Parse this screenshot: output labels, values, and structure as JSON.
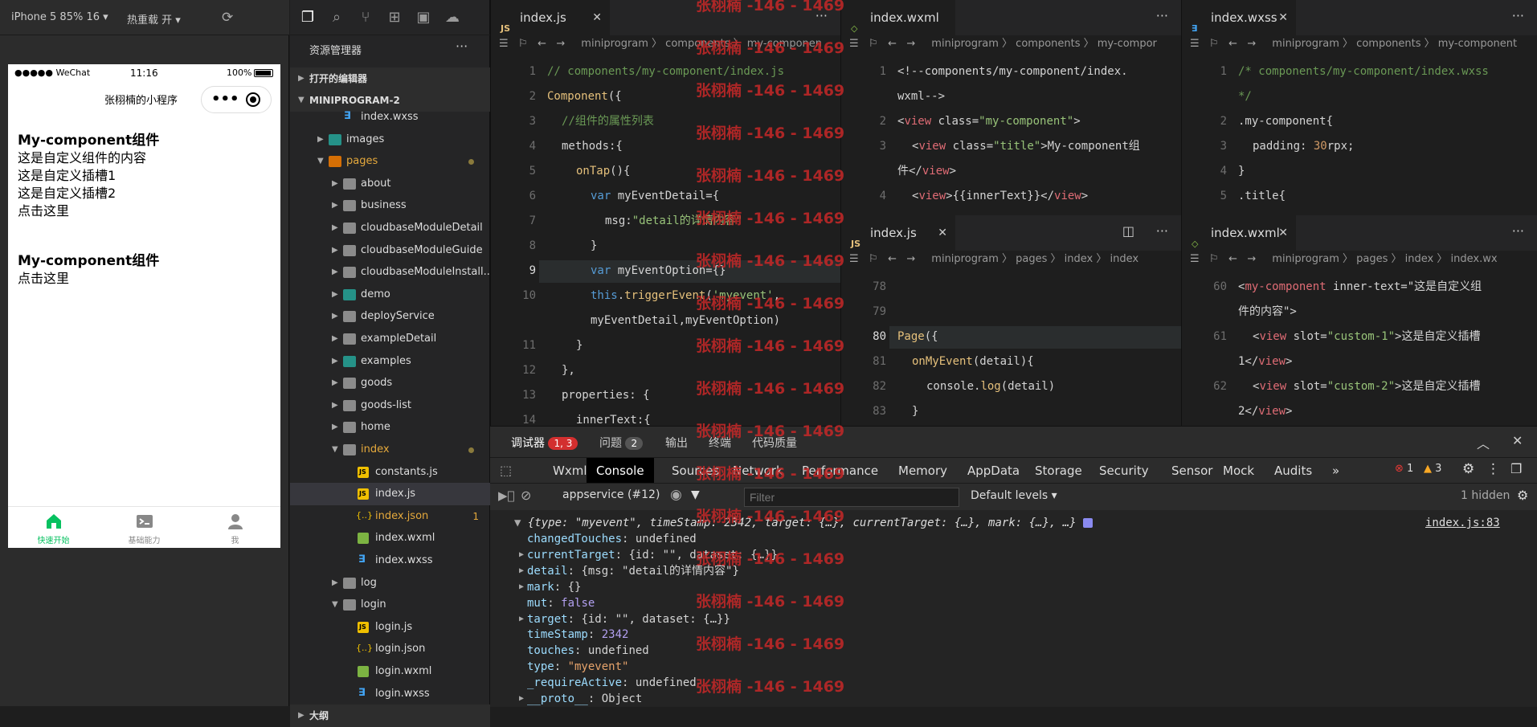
{
  "simulator": {
    "device": "iPhone 5 85% 16 ▾",
    "hot_reload": "热重载 开 ▾",
    "status": {
      "carrier": "●●●●● WeChat",
      "time": "11:16",
      "battery": "100%"
    },
    "nav_title": "张栩楠的小程序",
    "capsule_menu": "•••",
    "content": {
      "c1_title": "My-component组件",
      "c1_text": "这是自定义组件的内容",
      "c1_slot1": "这是自定义插槽1",
      "c1_slot2": "这是自定义插槽2",
      "c1_click": "点击这里",
      "c2_title": "My-component组件",
      "c2_click": "点击这里"
    },
    "tabs": [
      {
        "label": "快速开始",
        "color": "#07c160"
      },
      {
        "label": "基础能力",
        "color": "#888888"
      },
      {
        "label": "我",
        "color": "#888888"
      }
    ]
  },
  "explorer": {
    "title": "资源管理器",
    "more": "···",
    "open_editors": "打开的编辑器",
    "project": "MINIPROGRAM-2",
    "items": [
      {
        "label": "index.wxss",
        "type": "wxss"
      },
      {
        "label": "images",
        "type": "folder-img"
      },
      {
        "label": "pages",
        "type": "folder-o"
      },
      {
        "label": "about",
        "type": "folder"
      },
      {
        "label": "business",
        "type": "folder"
      },
      {
        "label": "cloudbaseModuleDetail",
        "type": "folder"
      },
      {
        "label": "cloudbaseModuleGuide",
        "type": "folder"
      },
      {
        "label": "cloudbaseModuleInstall...",
        "type": "folder"
      },
      {
        "label": "demo",
        "type": "folder-g"
      },
      {
        "label": "deployService",
        "type": "folder"
      },
      {
        "label": "exampleDetail",
        "type": "folder"
      },
      {
        "label": "examples",
        "type": "folder-g"
      },
      {
        "label": "goods",
        "type": "folder"
      },
      {
        "label": "goods-list",
        "type": "folder"
      },
      {
        "label": "home",
        "type": "folder"
      },
      {
        "label": "index",
        "type": "folder-open"
      },
      {
        "label": "constants.js",
        "type": "js"
      },
      {
        "label": "index.js",
        "type": "js"
      },
      {
        "label": "index.json",
        "type": "json",
        "badge": "1"
      },
      {
        "label": "index.wxml",
        "type": "wxml"
      },
      {
        "label": "index.wxss",
        "type": "wxss"
      },
      {
        "label": "log",
        "type": "folder"
      },
      {
        "label": "login",
        "type": "folder-open"
      },
      {
        "label": "login.js",
        "type": "js"
      },
      {
        "label": "login.json",
        "type": "json"
      },
      {
        "label": "login.wxml",
        "type": "wxml"
      },
      {
        "label": "login.wxss",
        "type": "wxss"
      },
      {
        "label": "大纲",
        "type": "section"
      }
    ]
  },
  "editors": {
    "e1": {
      "tab": "index.js",
      "crumb": "miniprogram 〉 components 〉 my-componen",
      "lines": [
        {
          "n": "1",
          "t": "// components/my-component/index.js"
        },
        {
          "n": "2",
          "t": "Component({"
        },
        {
          "n": "3",
          "t": "//组件的属性列表"
        },
        {
          "n": "4",
          "t": "methods:{"
        },
        {
          "n": "5",
          "t": "onTap(){"
        },
        {
          "n": "6",
          "t": "var myEventDetail={"
        },
        {
          "n": "7",
          "t": "msg:\"detail的详情内容\""
        },
        {
          "n": "8",
          "t": "}"
        },
        {
          "n": "9",
          "t": "var myEventOption={}"
        },
        {
          "n": "10",
          "t": "this.triggerEvent('myevent',"
        },
        {
          "n": "",
          "t": "myEventDetail,myEventOption)"
        },
        {
          "n": "11",
          "t": "}"
        },
        {
          "n": "12",
          "t": "},"
        },
        {
          "n": "13",
          "t": "properties: {"
        },
        {
          "n": "14",
          "t": "innerText:{"
        }
      ]
    },
    "e2": {
      "tab": "index.wxml",
      "crumb": "miniprogram 〉 components 〉 my-compor",
      "lines": [
        {
          "n": "1",
          "t": "<!--components/my-component/index."
        },
        {
          "n": "",
          "t": "wxml-->"
        },
        {
          "n": "2",
          "t": "<view class=\"my-component\">"
        },
        {
          "n": "3",
          "t": "<view class=\"title\">My-component组"
        },
        {
          "n": "",
          "t": "件</view>"
        },
        {
          "n": "4",
          "t": "<view>{{innerText}}</view>"
        }
      ]
    },
    "e3": {
      "tab": "index.wxss",
      "crumb": "miniprogram 〉 components 〉 my-component",
      "lines": [
        {
          "n": "1",
          "t": "/* components/my-component/index.wxss"
        },
        {
          "n": "",
          "t": "*/"
        },
        {
          "n": "2",
          "t": ".my-component{"
        },
        {
          "n": "3",
          "t": "padding: 30rpx;"
        },
        {
          "n": "4",
          "t": "}"
        },
        {
          "n": "5",
          "t": ".title{"
        }
      ]
    },
    "e4": {
      "tab": "index.js",
      "crumb": "miniprogram 〉 pages 〉 index 〉 index",
      "lines": [
        {
          "n": "78",
          "t": ""
        },
        {
          "n": "79",
          "t": ""
        },
        {
          "n": "80",
          "t": "Page({"
        },
        {
          "n": "81",
          "t": "onMyEvent(detail){"
        },
        {
          "n": "82",
          "t": "console.log(detail)"
        },
        {
          "n": "83",
          "t": "}"
        }
      ]
    },
    "e5": {
      "tab": "index.wxml",
      "crumb": "miniprogram 〉 pages 〉 index 〉 index.wx",
      "lines": [
        {
          "n": "60",
          "t": "<my-component inner-text=\"这是自定义组"
        },
        {
          "n": "",
          "t": "件的内容\">"
        },
        {
          "n": "61",
          "t": "<view slot=\"custom-1\">这是自定义插槽"
        },
        {
          "n": "",
          "t": "1</view>"
        },
        {
          "n": "62",
          "t": "<view slot=\"custom-2\">这是自定义插槽"
        },
        {
          "n": "",
          "t": "2</view>"
        },
        {
          "n": "63",
          "t": "</my-component>"
        }
      ]
    }
  },
  "watermark": "张栩楠 -146 - 1469",
  "devtools": {
    "tabs": [
      {
        "label": "调试器",
        "badge": "1, 3"
      },
      {
        "label": "问题",
        "badge": "2"
      },
      {
        "label": "输出"
      },
      {
        "label": "终端"
      },
      {
        "label": "代码质量"
      }
    ],
    "panels": [
      "Wxml",
      "Console",
      "Sources",
      "Network",
      "Performance",
      "Memory",
      "AppData",
      "Storage",
      "Security",
      "Sensor",
      "Mock",
      "Audits",
      "»"
    ],
    "errors": "1",
    "warnings": "3",
    "context": "appservice (#12)",
    "filter_placeholder": "Filter",
    "levels": "Default levels ▾",
    "hidden": "1 hidden",
    "source_link": "index.js:83",
    "log": {
      "summary": "{type: \"myevent\", timeStamp: 2342, target: {…}, currentTarget: {…}, mark: {…}, …}",
      "props": [
        {
          "k": "changedTouches",
          "v": "undefined",
          "c": "v",
          "arrow": false
        },
        {
          "k": "currentTarget",
          "v": "{id: \"\", dataset: {…}}",
          "c": "v",
          "arrow": true
        },
        {
          "k": "detail",
          "v": "{msg: \"detail的详情内容\"}",
          "c": "v",
          "arrow": true
        },
        {
          "k": "mark",
          "v": "{}",
          "c": "v",
          "arrow": true
        },
        {
          "k": "mut",
          "v": "false",
          "c": "vb",
          "arrow": false
        },
        {
          "k": "target",
          "v": "{id: \"\", dataset: {…}}",
          "c": "v",
          "arrow": true
        },
        {
          "k": "timeStamp",
          "v": "2342",
          "c": "vn",
          "arrow": false
        },
        {
          "k": "touches",
          "v": "undefined",
          "c": "v",
          "arrow": false
        },
        {
          "k": "type",
          "v": "\"myevent\"",
          "c": "vs",
          "arrow": false
        },
        {
          "k": "_requireActive",
          "v": "undefined",
          "c": "v",
          "arrow": false
        },
        {
          "k": "__proto__",
          "v": "Object",
          "c": "v",
          "arrow": true
        }
      ]
    }
  }
}
